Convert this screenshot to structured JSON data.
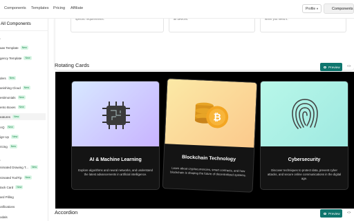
{
  "nav": {
    "items": [
      "Components",
      "Templates",
      "Pricing",
      "Affiliate"
    ]
  },
  "header": {
    "profile_label": "Profile",
    "components_button": "Components"
  },
  "sidebar": {
    "title": "All Components",
    "categories": [
      "s",
      "s"
    ],
    "items": [
      {
        "label": "aas Template",
        "badge": "New"
      },
      {
        "label": "gency Template",
        "badge": "New"
      },
      {
        "label": "ders",
        "badge": "New"
      },
      {
        "label": "anishing Cloud",
        "badge": "New"
      },
      {
        "label": "estimonials",
        "badge": "New"
      },
      {
        "label": "ento Boxes",
        "badge": "New"
      },
      {
        "label": "eatures",
        "badge": "New"
      },
      {
        "label": "AQ",
        "badge": "New"
      },
      {
        "label": "ign Up",
        "badge": "New"
      },
      {
        "label": "ricing",
        "badge": "New"
      },
      {
        "label": "nimated Drawing T...",
        "badge": "New"
      },
      {
        "label": "nimated ToolTip",
        "badge": "New"
      },
      {
        "label": "tack Card",
        "badge": "New"
      },
      {
        "label": "ard Pilling",
        "badge": ""
      },
      {
        "label": "otifications",
        "badge": ""
      },
      {
        "label": "odals",
        "badge": ""
      }
    ]
  },
  "prev_section": {
    "snippets": [
      "specific requirements.",
      "all devices.",
      "when you need it."
    ]
  },
  "rotating": {
    "title": "Rotating Cards",
    "preview_label": "Preview",
    "code_label": "<>",
    "cards": [
      {
        "title": "AI & Machine Learning",
        "description": "Explore algorithms and neural networks, and understand the latest advancements in artificial intelligence.",
        "icon": "chip-icon",
        "accent": "#c9b8f5"
      },
      {
        "title": "Blockchain Technology",
        "description": "Learn about cryptocurrencies, smart contracts, and how blockchain is shaping the future of decentralized systems.",
        "icon": "bitcoin-icon",
        "accent": "#fcd98a"
      },
      {
        "title": "Cybersecurity",
        "description": "Discover techniques to protect data, prevent cyber attacks, and secure online communications in the digital age.",
        "icon": "fingerprint-icon",
        "accent": "#a6f1e2"
      }
    ]
  },
  "accordion": {
    "title": "Accordion",
    "preview_label": "Preview",
    "code_label": "<>"
  },
  "colors": {
    "accent": "#0f766e",
    "badge_bg": "#d9f5e5",
    "badge_text": "#1a8a4d"
  }
}
